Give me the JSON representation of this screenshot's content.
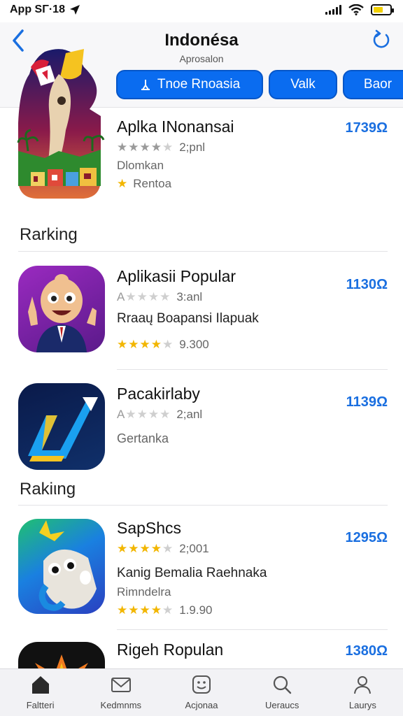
{
  "status": {
    "app_label": "App SΓ·18"
  },
  "header": {
    "title": "Indonésa",
    "subtitle": "Aprosalon",
    "chips": [
      {
        "label": "Tnoe Rnoasia"
      },
      {
        "label": "Valk"
      },
      {
        "label": "Baor"
      }
    ]
  },
  "apps": [
    {
      "name": "Aplka INonansai",
      "rating_text": "2;pnl",
      "line2": "Dlomkan",
      "line3": "Rentoa",
      "price": "1739Ω"
    },
    {
      "name": "Aplikasii Popular",
      "rating_text": "3:anl",
      "line2": "Rraaų Boapansi Ilapuak",
      "line3": "9.300",
      "price": "1130Ω"
    },
    {
      "name": "Pacakirlaby",
      "rating_text": "2;anl",
      "line2": "Gertanka",
      "price": "1139Ω"
    },
    {
      "name": "SapShcs",
      "rating_text": "2;001",
      "line2": "Kanig Bemalia Raehnaka",
      "line3": "Rimndelra",
      "line4": "1.9.90",
      "price": "1295Ω"
    },
    {
      "name": "Rigeh Ropulan",
      "price": "1380Ω"
    }
  ],
  "ratings": [
    {
      "app": "Aplka INonansai",
      "value": 4,
      "max": 5
    },
    {
      "app": "Aplikasii Popular",
      "value": 1,
      "max": 5
    },
    {
      "app": "Aplikasii Popular",
      "value": 4.5,
      "max": 5
    },
    {
      "app": "Pacakirlaby",
      "value": 1,
      "max": 5
    },
    {
      "app": "SapShcs",
      "value": 4.5,
      "max": 5
    },
    {
      "app": "SapShcs",
      "value": 4.5,
      "max": 5
    }
  ],
  "sections": [
    {
      "label": "Rarking"
    },
    {
      "label": "Rakiιng"
    }
  ],
  "tabbar": [
    {
      "label": "Faltteri",
      "icon": "home-icon"
    },
    {
      "label": "Kedmnms",
      "icon": "envelope-icon"
    },
    {
      "label": "Acjonaa",
      "icon": "smiley-icon"
    },
    {
      "label": "Ueraucs",
      "icon": "search-icon"
    },
    {
      "label": "Laurys",
      "icon": "user-icon"
    }
  ],
  "colors": {
    "accent": "#0a6cf0",
    "price": "#1a6fe0",
    "star": "#f2b600"
  }
}
